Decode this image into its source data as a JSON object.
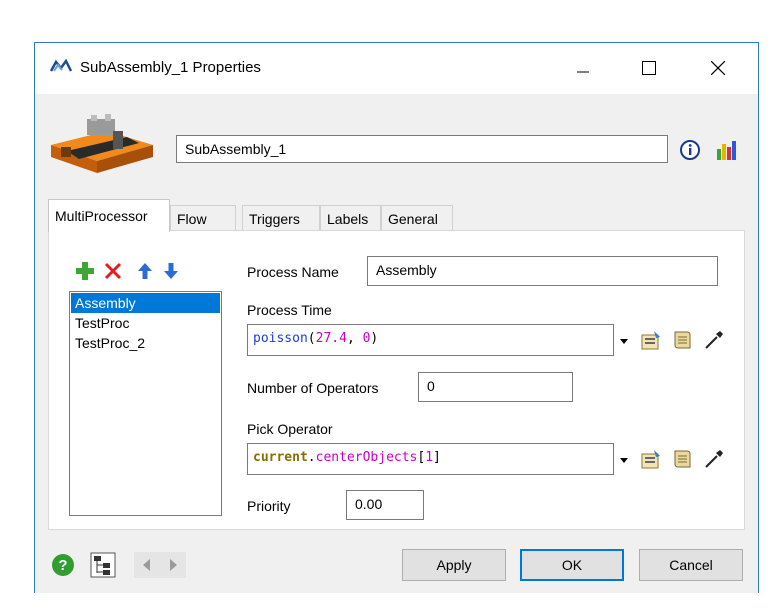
{
  "window": {
    "title": "SubAssembly_1  Properties"
  },
  "object": {
    "name": "SubAssembly_1"
  },
  "tabs": [
    "MultiProcessor",
    "Flow",
    "Triggers",
    "Labels",
    "General"
  ],
  "processes": [
    "Assembly",
    "TestProc",
    "TestProc_2"
  ],
  "form": {
    "process_name_label": "Process Name",
    "process_name_value": "Assembly",
    "process_time_label": "Process Time",
    "process_time_code": {
      "fn": "poisson",
      "open": "(",
      "a": "27.4",
      "sep": ", ",
      "b": "0",
      "close": ")"
    },
    "num_operators_label": "Number of Operators",
    "num_operators_value": "0",
    "pick_operator_label": "Pick Operator",
    "pick_operator_code": {
      "obj": "current",
      "dot": ".",
      "member": "centerObjects",
      "open": "[",
      "idx": "1",
      "close": "]"
    },
    "priority_label": "Priority",
    "priority_value": "0.00"
  },
  "buttons": {
    "apply": "Apply",
    "ok": "OK",
    "cancel": "Cancel"
  },
  "colors": {
    "accent": "#0078d7",
    "add": "#3fa535",
    "delete": "#e02020",
    "arrow": "#2b6cd4"
  }
}
